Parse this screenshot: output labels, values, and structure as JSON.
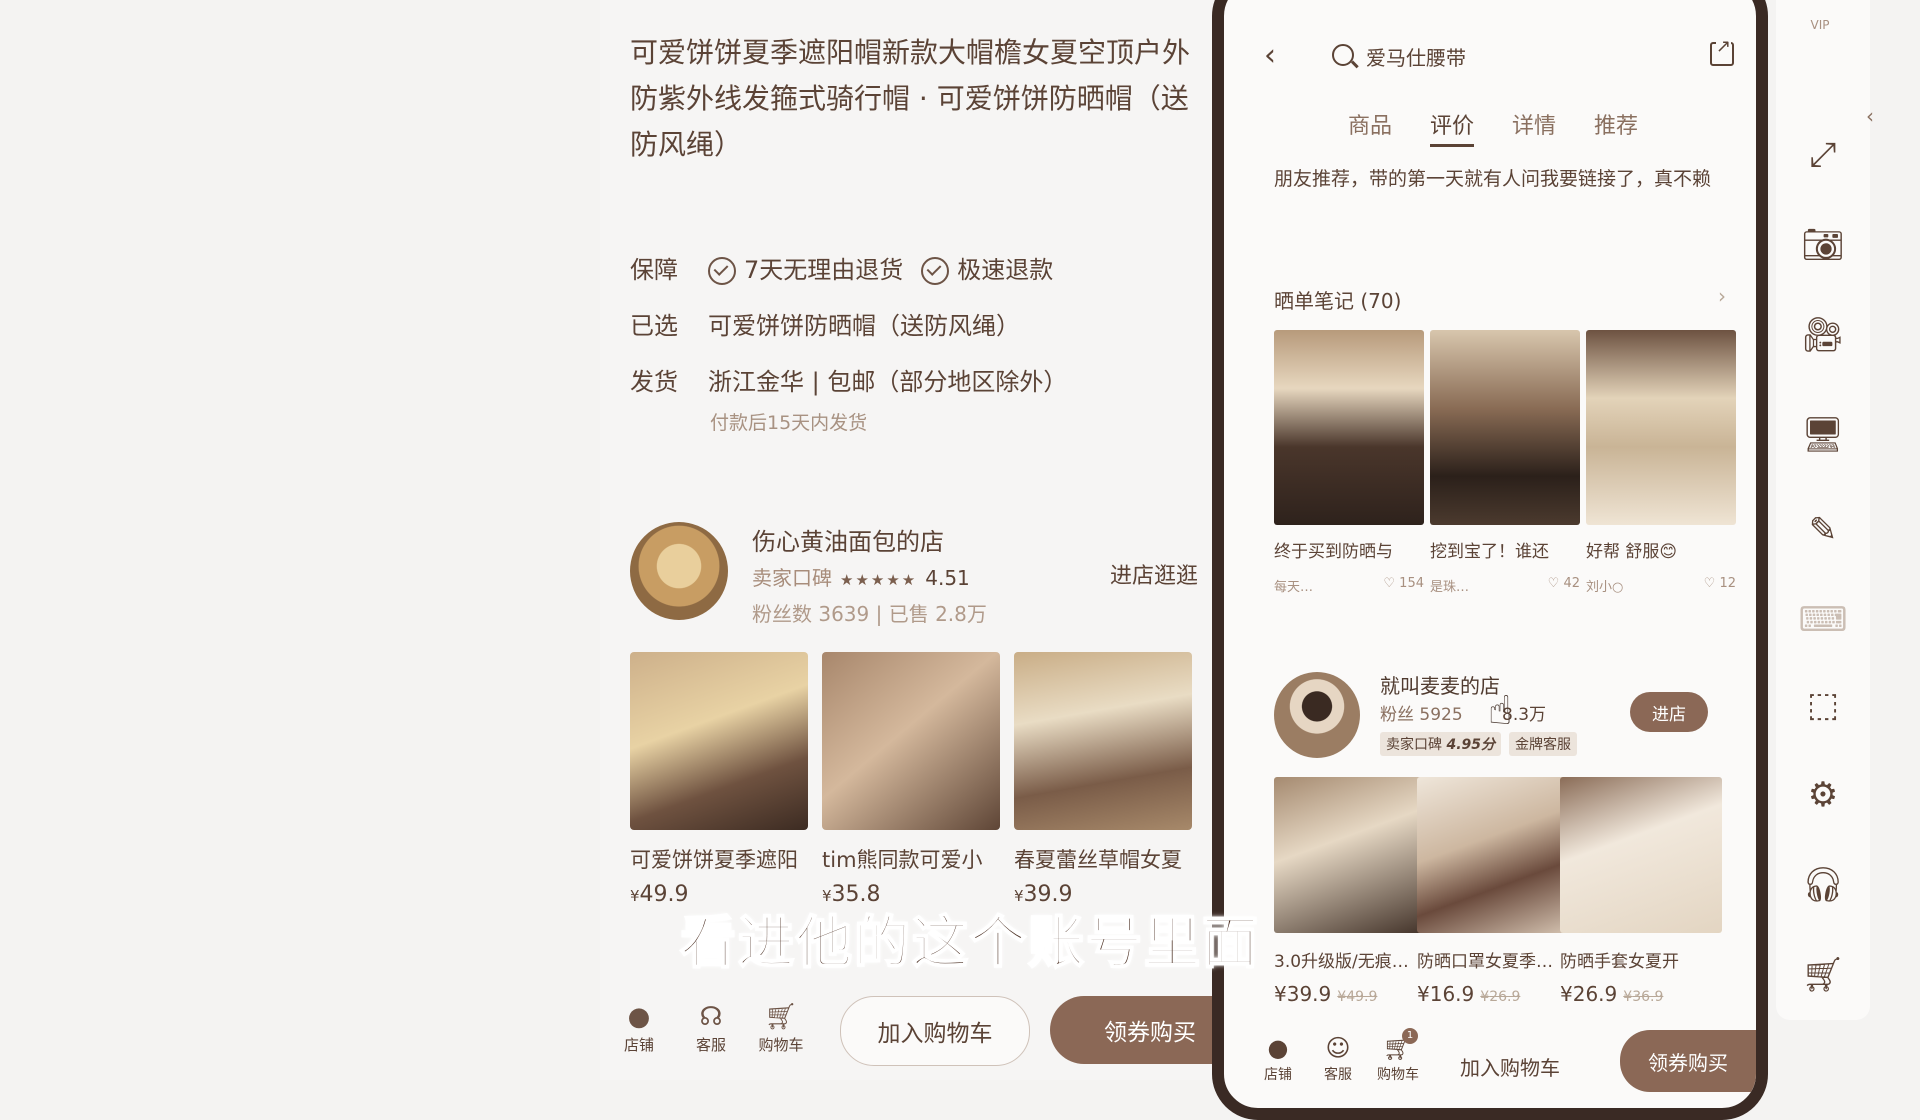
{
  "left_panel": {
    "title": "可爱饼饼夏季遮阳帽新款大帽檐女夏空顶户外防紫外线发箍式骑行帽 · 可爱饼饼防晒帽（送防风绳）",
    "guarantee_label": "保障",
    "guarantee_1": "7天无理由退货",
    "guarantee_2": "极速退款",
    "selected_label": "已选",
    "selected_value": "可爱饼饼防晒帽（送防风绳）",
    "ship_label": "发货",
    "ship_value": "浙江金华 | 包邮（部分地区除外）",
    "ship_note": "付款后15天内发货",
    "shop": {
      "name": "伤心黄油面包的店",
      "rating_label": "卖家口碑",
      "stars": "★★★★★",
      "score": "4.51",
      "fans": "粉丝数 3639 | 已售 2.8万",
      "visit": "进店逛逛"
    },
    "products": [
      {
        "name": "可爱饼饼夏季遮阳",
        "price": "49.9"
      },
      {
        "name": "tim熊同款可爱小",
        "price": "35.8"
      },
      {
        "name": "春夏蕾丝草帽女夏",
        "price": "39.9"
      }
    ],
    "bottom": {
      "store": "店铺",
      "service": "客服",
      "cart": "购物车",
      "add_cart": "加入购物车",
      "buy": "领券购买"
    }
  },
  "phone": {
    "search_text": "爱马仕腰带",
    "tabs": [
      "商品",
      "评价",
      "详情",
      "推荐"
    ],
    "review_text": "朋友推荐，带的第一天就有人问我要链接了，真不赖",
    "notes_title": "晒单笔记 (70)",
    "notes": [
      {
        "text": "终于买到防晒与",
        "user": "每天…",
        "likes": "♡ 154"
      },
      {
        "text": "挖到宝了！谁还",
        "user": "是珠…",
        "likes": "♡ 42"
      },
      {
        "text": "好帮 舒服😊",
        "user": "刘小○",
        "likes": "♡ 12"
      }
    ],
    "shop": {
      "name": "就叫麦麦的店",
      "fans": "粉丝 5925",
      "sold": "8.3万",
      "badge_label": "卖家口碑",
      "badge_score": "4.95分",
      "badge_service": "金牌客服",
      "visit": "进店"
    },
    "recommend": [
      {
        "name": "3.0升级版/无痕…",
        "price": "39.9",
        "old": "49.9"
      },
      {
        "name": "防晒口罩女夏季…",
        "price": "16.9",
        "old": "26.9"
      },
      {
        "name": "防晒手套女夏开",
        "price": "26.9",
        "old": "36.9"
      }
    ],
    "bottom": {
      "store": "店铺",
      "service": "客服",
      "cart": "购物车",
      "cart_count": "1",
      "add_cart": "加入购物车",
      "buy": "领券购买"
    }
  },
  "rail": {
    "vip": "VIP"
  },
  "subtitle": "看进他的这个账号里面"
}
